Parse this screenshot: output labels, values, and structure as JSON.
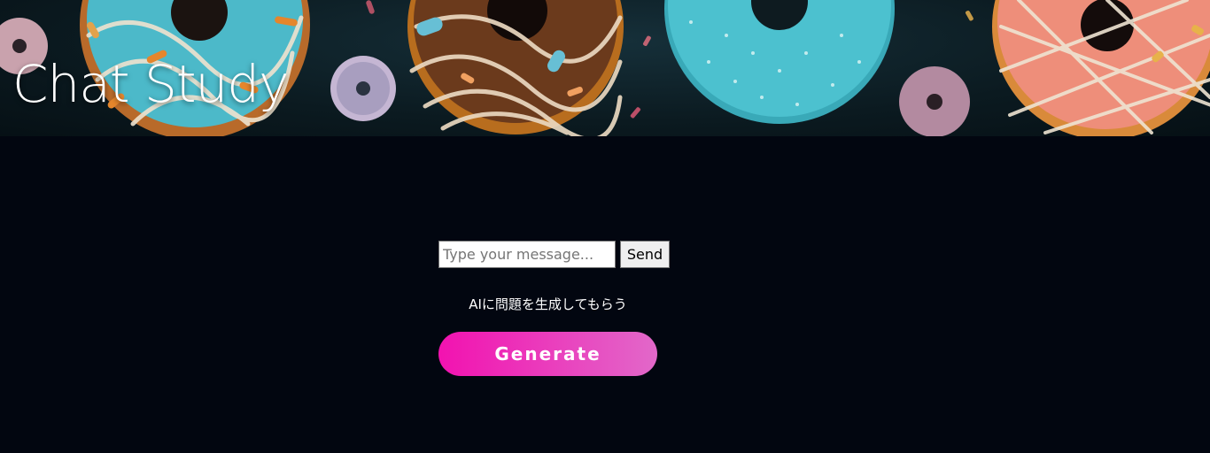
{
  "header": {
    "title": "Chat Study",
    "banner_image": "donuts-banner"
  },
  "chat": {
    "input_value": "",
    "input_placeholder": "Type your message...",
    "send_label": "Send"
  },
  "generate": {
    "hint": "AIに問題を生成してもらう",
    "button_label": "Generate"
  },
  "colors": {
    "background": "#020610",
    "accent_start": "#f212b0",
    "accent_end": "#e268c9"
  }
}
